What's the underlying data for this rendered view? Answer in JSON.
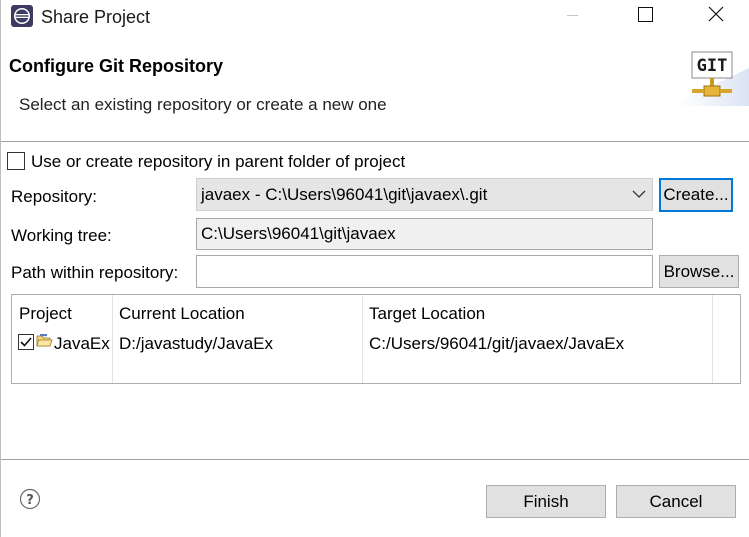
{
  "window": {
    "title": "Share Project",
    "app_icon": "eclipse-icon",
    "controls": [
      "minimize-icon",
      "maximize-icon",
      "close-icon"
    ]
  },
  "header": {
    "title": "Configure Git Repository",
    "description": "Select an existing repository or create a new one",
    "logo_text": "GIT"
  },
  "form": {
    "parent_checkbox_label": "Use or create repository in parent folder of project",
    "parent_checkbox_checked": false,
    "repository_label": "Repository:",
    "repository_value": "javaex - C:\\Users\\96041\\git\\javaex\\.git",
    "create_button": "Create...",
    "working_tree_label": "Working tree:",
    "working_tree_value": "C:\\Users\\96041\\git\\javaex",
    "path_label": "Path within repository:",
    "path_value": "",
    "browse_button": "Browse..."
  },
  "table": {
    "columns": [
      "Project",
      "Current Location",
      "Target Location"
    ],
    "rows": [
      {
        "checked": true,
        "project": "JavaEx",
        "current_location": "D:/javastudy/JavaEx",
        "target_location": "C:/Users/96041/git/javaex/JavaEx"
      }
    ]
  },
  "footer": {
    "help_icon": "help-icon",
    "finish_button": "Finish",
    "cancel_button": "Cancel"
  },
  "colors": {
    "focus_border": "#0078d7",
    "button_bg": "#e1e1e1",
    "readonly_bg": "#f0f0f0"
  }
}
